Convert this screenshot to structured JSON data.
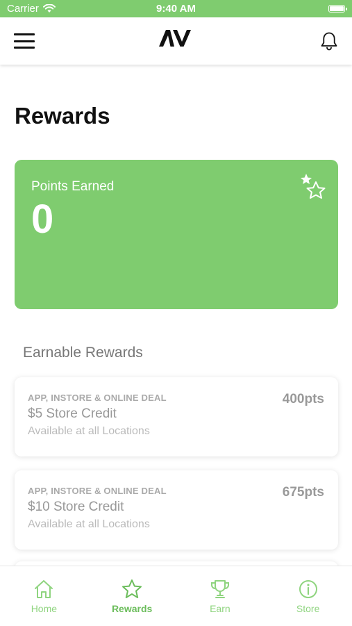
{
  "status_bar": {
    "carrier": "Carrier",
    "time": "9:40 AM",
    "battery_level": 1.0
  },
  "nav": {
    "logo_text": "AV"
  },
  "page": {
    "title": "Rewards"
  },
  "points_card": {
    "label": "Points Earned",
    "value": "0",
    "background_color": "#7fcc6f"
  },
  "earnable": {
    "title": "Earnable Rewards",
    "items": [
      {
        "tag": "APP, INSTORE & ONLINE DEAL",
        "name": "$5 Store Credit",
        "availability": "Available at all Locations",
        "points": "400pts"
      },
      {
        "tag": "APP, INSTORE & ONLINE DEAL",
        "name": "$10 Store Credit",
        "availability": "Available at all Locations",
        "points": "675pts"
      }
    ]
  },
  "tabs": [
    {
      "label": "Home",
      "icon": "home-icon",
      "active": false
    },
    {
      "label": "Rewards",
      "icon": "star-icon",
      "active": true
    },
    {
      "label": "Earn",
      "icon": "trophy-icon",
      "active": false
    },
    {
      "label": "Store",
      "icon": "info-icon",
      "active": false
    }
  ],
  "colors": {
    "accent": "#7fcc6f",
    "tab_active": "#6cbd5c"
  }
}
